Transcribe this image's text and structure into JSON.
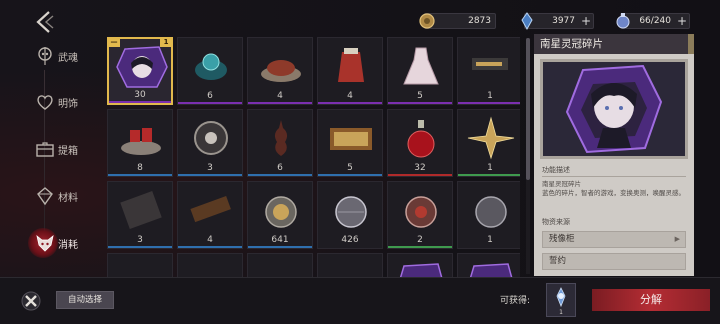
{
  "resources": [
    {
      "name": "coin",
      "value": "2873",
      "has_plus": false
    },
    {
      "name": "crystal",
      "value": "3977",
      "has_plus": true
    },
    {
      "name": "energy",
      "value": "66/240",
      "has_plus": true
    }
  ],
  "nav": {
    "items": [
      {
        "label": "武魂",
        "icon": "skull-sword-icon"
      },
      {
        "label": "明饰",
        "icon": "heart-crest-icon"
      },
      {
        "label": "提箱",
        "icon": "chest-icon"
      },
      {
        "label": "材料",
        "icon": "gem-icon"
      },
      {
        "label": "消耗",
        "icon": "fox-mask-icon",
        "active": true
      }
    ]
  },
  "inventory": {
    "cells": [
      {
        "count": "30",
        "kind": "portrait-shard",
        "rarity": "purple",
        "selected": true,
        "tag_left": "—",
        "tag_right": "1"
      },
      {
        "count": "6",
        "kind": "teal-orb",
        "rarity": "purple"
      },
      {
        "count": "4",
        "kind": "meat-plate",
        "rarity": "purple"
      },
      {
        "count": "4",
        "kind": "potion-bag",
        "rarity": "purple"
      },
      {
        "count": "5",
        "kind": "dress",
        "rarity": "purple"
      },
      {
        "count": "1",
        "kind": "gun",
        "rarity": "purple"
      },
      {
        "count": "8",
        "kind": "gift-plate",
        "rarity": "blue"
      },
      {
        "count": "3",
        "kind": "ring-tray",
        "rarity": "blue"
      },
      {
        "count": "6",
        "kind": "violin",
        "rarity": "blue"
      },
      {
        "count": "5",
        "kind": "books",
        "rarity": "blue"
      },
      {
        "count": "32",
        "kind": "red-potion",
        "rarity": "red"
      },
      {
        "count": "1",
        "kind": "compass",
        "rarity": "green"
      },
      {
        "count": "3",
        "kind": "scroll",
        "rarity": "blue"
      },
      {
        "count": "4",
        "kind": "wood-block",
        "rarity": "blue"
      },
      {
        "count": "641",
        "kind": "gold-orb",
        "rarity": "blue"
      },
      {
        "count": "426",
        "kind": "silver-orb",
        "rarity": "none"
      },
      {
        "count": "2",
        "kind": "red-orb",
        "rarity": "green"
      },
      {
        "count": "1",
        "kind": "gray-orb",
        "rarity": "none"
      },
      {
        "count": "",
        "kind": "red-item",
        "rarity": "none"
      },
      {
        "count": "",
        "kind": "red-item",
        "rarity": "none"
      },
      {
        "count": "",
        "kind": "red-item",
        "rarity": "none"
      },
      {
        "count": "",
        "kind": "red-item",
        "rarity": "none"
      },
      {
        "count": "",
        "kind": "purple-shard",
        "rarity": "none"
      },
      {
        "count": "",
        "kind": "purple-shard",
        "rarity": "none"
      }
    ]
  },
  "detail": {
    "title": "南星灵冠碎片",
    "section_desc": "功能描述",
    "desc_name": "南星灵冠碎片",
    "desc_text": "蓝色的碎片，智者的游戏，变换奥测，唤醒灵感。",
    "section_source": "物资来源",
    "sources": [
      {
        "label": "残像柜",
        "arrow": "▶"
      },
      {
        "label": "誓约",
        "arrow": ""
      }
    ]
  },
  "bottom": {
    "auto_select": "自动选择",
    "obtainable": "可获得:",
    "gain_count": "1",
    "decompose": "分解"
  },
  "colors": {
    "purple": "#7b2fb0",
    "blue": "#2f6fae",
    "red": "#b02a2a",
    "green": "#3f9a4e",
    "gold": "#e2b94d",
    "accent": "#b52d34"
  }
}
